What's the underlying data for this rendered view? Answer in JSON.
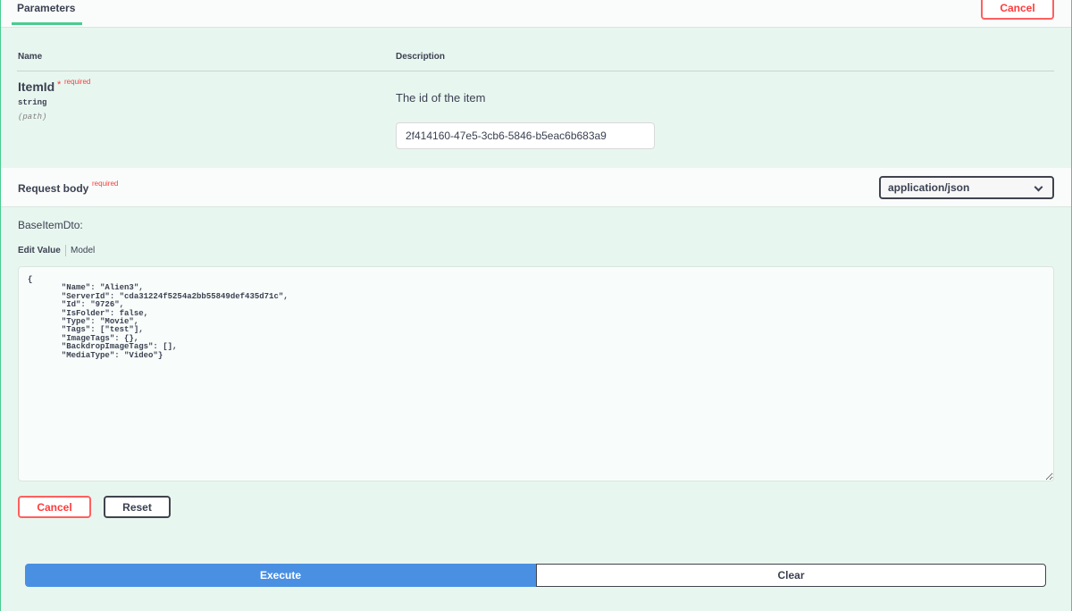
{
  "parameters": {
    "tab_label": "Parameters",
    "cancel_label": "Cancel",
    "columns": {
      "name": "Name",
      "description": "Description"
    },
    "items": [
      {
        "name": "ItemId",
        "required_star": "*",
        "required_label": "required",
        "type": "string",
        "in": "(path)",
        "description": "The id of the item",
        "value": "2f414160-47e5-3cb6-5846-b5eac6b683a9"
      }
    ]
  },
  "request_body": {
    "title": "Request body",
    "required_label": "required",
    "content_type": "application/json",
    "schema_name": "BaseItemDto:",
    "tabs": {
      "edit_value": "Edit Value",
      "model": "Model"
    },
    "value": "{\n       \"Name\": \"Alien3\",\n       \"ServerId\": \"cda31224f5254a2bb55849def435d71c\",\n       \"Id\": \"9726\",\n       \"IsFolder\": false,\n       \"Type\": \"Movie\",\n       \"Tags\": [\"test\"],\n       \"ImageTags\": {},\n       \"BackdropImageTags\": [],\n       \"MediaType\": \"Video\"}",
    "cancel_label": "Cancel",
    "reset_label": "Reset"
  },
  "actions": {
    "execute_label": "Execute",
    "clear_label": "Clear"
  },
  "colors": {
    "accent_green": "#49cc90",
    "panel_bg": "#e8f6f0",
    "cancel_red": "#ff3b3b",
    "execute_blue": "#4990e2"
  }
}
